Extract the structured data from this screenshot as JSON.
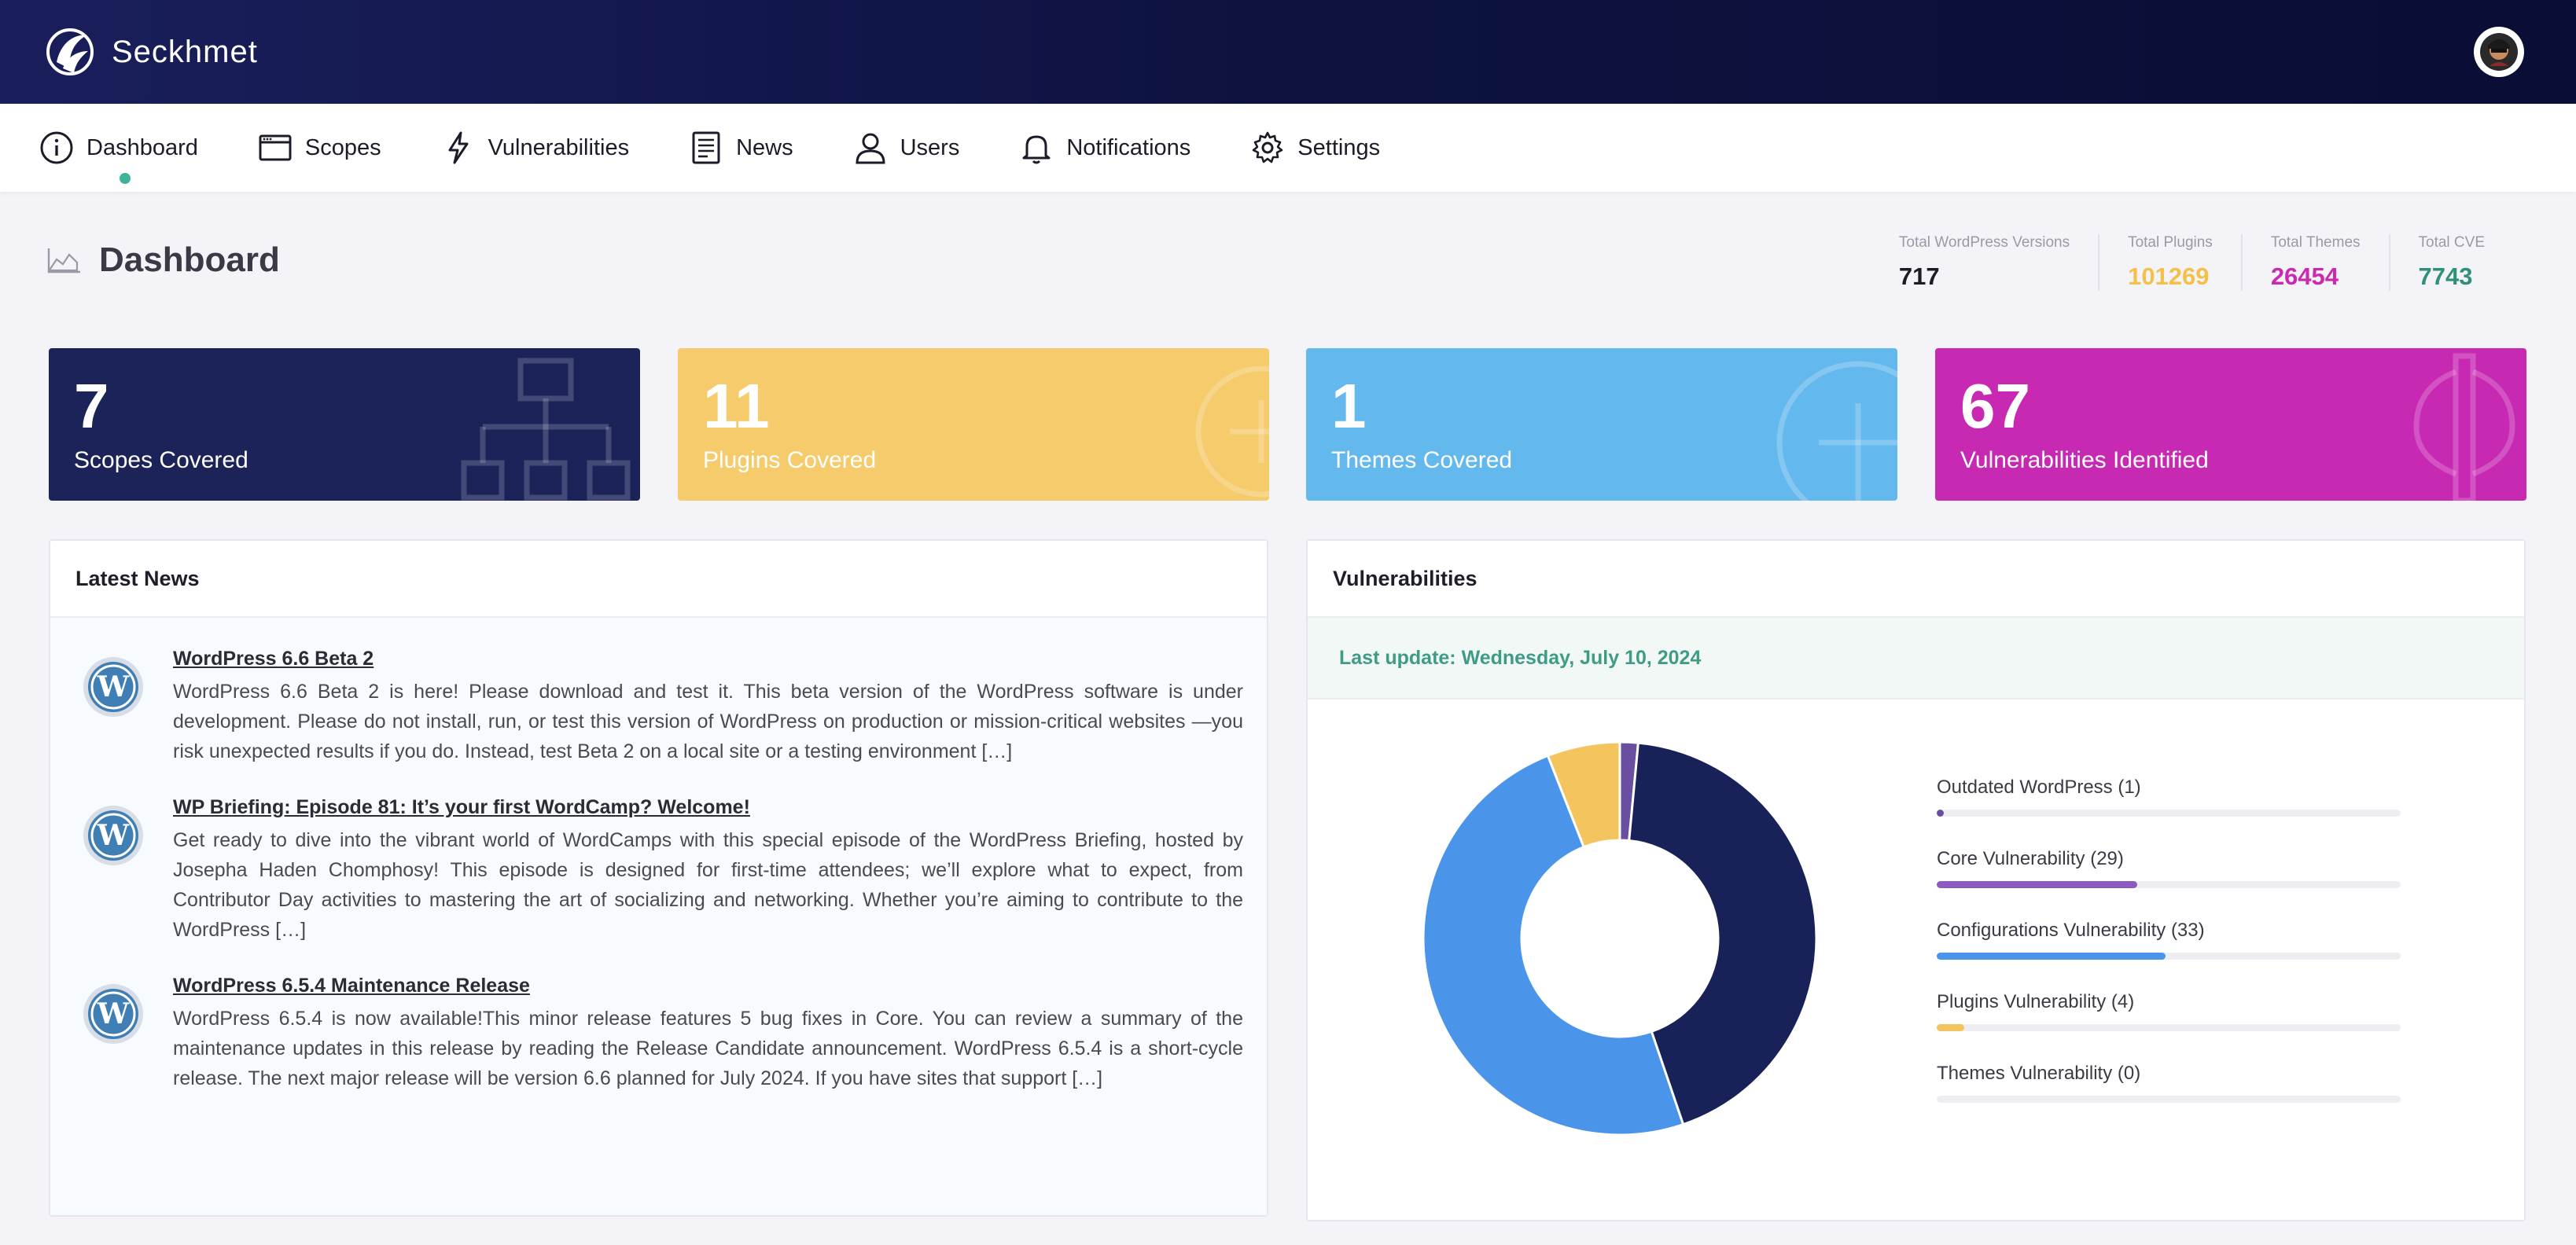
{
  "app": {
    "name": "Seckhmet"
  },
  "nav": [
    {
      "label": "Dashboard",
      "icon": "info-icon",
      "active": true
    },
    {
      "label": "Scopes",
      "icon": "browser-window-icon"
    },
    {
      "label": "Vulnerabilities",
      "icon": "lightning-icon"
    },
    {
      "label": "News",
      "icon": "newspaper-icon"
    },
    {
      "label": "Users",
      "icon": "user-icon"
    },
    {
      "label": "Notifications",
      "icon": "bell-icon"
    },
    {
      "label": "Settings",
      "icon": "gear-icon"
    }
  ],
  "page": {
    "title": "Dashboard"
  },
  "stats": [
    {
      "label": "Total WordPress Versions",
      "value": "717",
      "color": "#1c1c28"
    },
    {
      "label": "Total Plugins",
      "value": "101269",
      "color": "#f5c04a"
    },
    {
      "label": "Total Themes",
      "value": "26454",
      "color": "#c92ab0"
    },
    {
      "label": "Total CVE",
      "value": "7743",
      "color": "#2e8f7a"
    }
  ],
  "cards": [
    {
      "value": "7",
      "label": "Scopes Covered",
      "color": "#1b2358",
      "icon": "hierarchy-icon"
    },
    {
      "value": "11",
      "label": "Plugins Covered",
      "color": "#f5cb6b",
      "icon": "plus-circle-icon"
    },
    {
      "value": "1",
      "label": "Themes Covered",
      "color": "#63b8ee",
      "icon": "plus-circle-icon"
    },
    {
      "value": "67",
      "label": "Vulnerabilities Identified",
      "color": "#c829b3",
      "icon": "axe-icon"
    }
  ],
  "news": {
    "title": "Latest News",
    "items": [
      {
        "title": "WordPress 6.6 Beta 2",
        "text": "WordPress 6.6 Beta 2 is here! Please download and test it. This beta version of the WordPress software is under development. Please do not install, run, or test this version of WordPress on production or mission-critical websites —you risk unexpected results if you do. Instead, test Beta 2 on a local site or a testing environment […]"
      },
      {
        "title": "WP Briefing: Episode 81: It’s your first WordCamp? Welcome!",
        "text": "Get ready to dive into the vibrant world of WordCamps with this special episode of the WordPress Briefing, hosted by Josepha Haden Chomphosy! This episode is designed for first-time attendees; we’ll explore what to expect, from Contributor Day activities to mastering the art of socializing and networking. Whether you’re aiming to contribute to the WordPress […]"
      },
      {
        "title": "WordPress 6.5.4 Maintenance Release",
        "text": "WordPress 6.5.4 is now available!This minor release features 5 bug fixes in Core. You can review a summary of the maintenance updates in this release by reading the Release Candidate announcement. WordPress 6.5.4 is a short-cycle release. The next major release will be version 6.6 planned for July 2024. If you have sites that support […]"
      }
    ]
  },
  "vulns": {
    "title": "Vulnerabilities",
    "last_update": "Last update: Wednesday, July 10, 2024"
  },
  "chart_data": {
    "type": "pie",
    "categories": [
      "Outdated WordPress",
      "Core Vulnerability",
      "Configurations Vulnerability",
      "Plugins Vulnerability",
      "Themes Vulnerability"
    ],
    "values": [
      1,
      29,
      33,
      4,
      0
    ],
    "legend_labels": [
      "Outdated WordPress (1)",
      "Core Vulnerability (29)",
      "Configurations Vulnerability (33)",
      "Plugins Vulnerability (4)",
      "Themes Vulnerability (0)"
    ],
    "colors": [
      "#6a4fa0",
      "#182258",
      "#4a95ea",
      "#f4c55e",
      "#cccccc"
    ],
    "bar_colors": [
      "#6a4fa0",
      "#8a5cbf",
      "#4a95ea",
      "#f4c55e",
      "#cccccc"
    ],
    "bar_max": 67,
    "legend_placement": "right"
  }
}
